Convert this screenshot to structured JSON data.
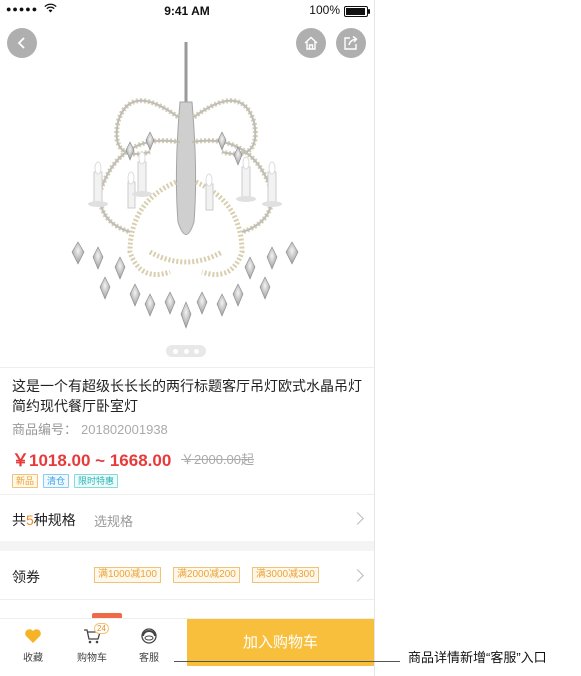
{
  "status_bar": {
    "signal": "●●●●●",
    "time": "9:41 AM",
    "battery": "100%",
    "battery_level": 1.0
  },
  "hero": {
    "image_subject": "crystal-chandelier",
    "carousel_dots": 3,
    "active_dot": 0
  },
  "product": {
    "title": "这是一个有超级长长长的两行标题客厅吊灯欧式水晶吊灯简约现代餐厅卧室灯",
    "code_label": "商品编号：",
    "code_value": "201802001938",
    "price": "￥1018.00 ~ 1668.00",
    "old_price": "￥2000.00起",
    "tags": [
      "新品",
      "清仓",
      "限时特惠"
    ]
  },
  "spec": {
    "prefix": "共",
    "count": "5",
    "suffix": "种规格",
    "hint": "选规格"
  },
  "coupon": {
    "label": "领券",
    "items": [
      "满1000减100",
      "满2000减200",
      "满3000减300"
    ]
  },
  "bottom_bar": {
    "favorite_label": "收藏",
    "cart_label": "购物车",
    "cart_count": "24",
    "service_label": "客服",
    "add_to_cart": "加入购物车"
  },
  "annotation": {
    "text": "商品详情新增“客服”入口"
  },
  "colors": {
    "price": "#e83a3a",
    "add_cart_bg": "#f7bf3c",
    "accent_orange": "#f08c1e",
    "favorite": "#f5b428"
  }
}
